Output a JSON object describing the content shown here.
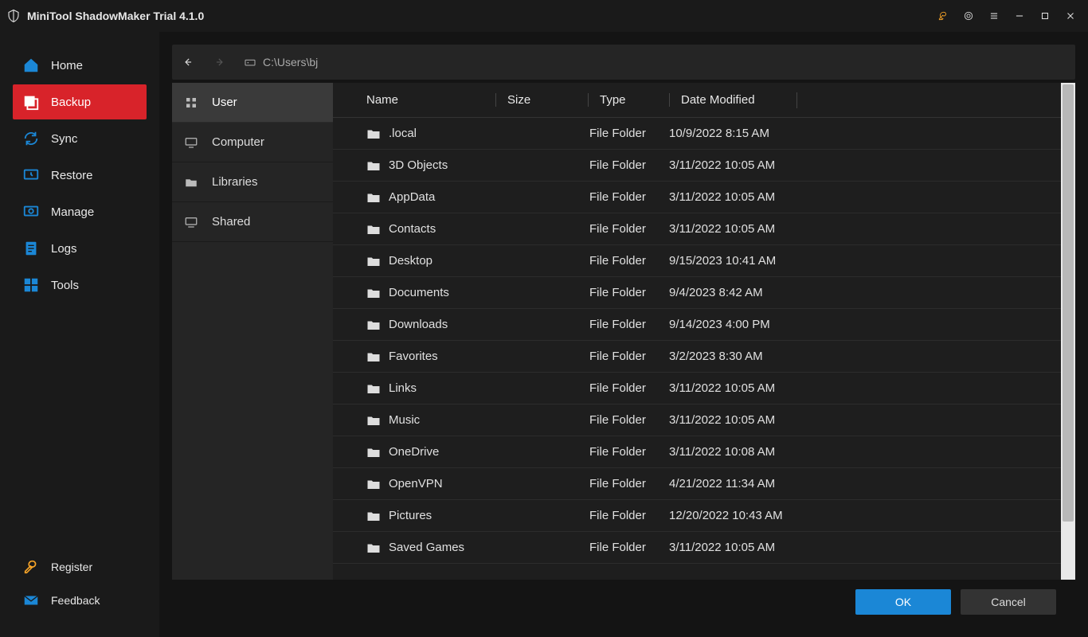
{
  "title": "MiniTool ShadowMaker Trial 4.1.0",
  "sidebar": {
    "items": [
      {
        "label": "Home"
      },
      {
        "label": "Backup"
      },
      {
        "label": "Sync"
      },
      {
        "label": "Restore"
      },
      {
        "label": "Manage"
      },
      {
        "label": "Logs"
      },
      {
        "label": "Tools"
      }
    ],
    "active_index": 1,
    "bottom": [
      {
        "label": "Register"
      },
      {
        "label": "Feedback"
      }
    ]
  },
  "browser": {
    "path": "C:\\Users\\bj",
    "categories": [
      {
        "label": "User"
      },
      {
        "label": "Computer"
      },
      {
        "label": "Libraries"
      },
      {
        "label": "Shared"
      }
    ],
    "active_category": 0,
    "columns": {
      "name": "Name",
      "size": "Size",
      "type": "Type",
      "date": "Date Modified"
    },
    "rows": [
      {
        "name": ".local",
        "type": "File Folder",
        "date": "10/9/2022 8:15 AM"
      },
      {
        "name": "3D Objects",
        "type": "File Folder",
        "date": "3/11/2022 10:05 AM"
      },
      {
        "name": "AppData",
        "type": "File Folder",
        "date": "3/11/2022 10:05 AM"
      },
      {
        "name": "Contacts",
        "type": "File Folder",
        "date": "3/11/2022 10:05 AM"
      },
      {
        "name": "Desktop",
        "type": "File Folder",
        "date": "9/15/2023 10:41 AM"
      },
      {
        "name": "Documents",
        "type": "File Folder",
        "date": "9/4/2023 8:42 AM"
      },
      {
        "name": "Downloads",
        "type": "File Folder",
        "date": "9/14/2023 4:00 PM"
      },
      {
        "name": "Favorites",
        "type": "File Folder",
        "date": "3/2/2023 8:30 AM"
      },
      {
        "name": "Links",
        "type": "File Folder",
        "date": "3/11/2022 10:05 AM"
      },
      {
        "name": "Music",
        "type": "File Folder",
        "date": "3/11/2022 10:05 AM"
      },
      {
        "name": "OneDrive",
        "type": "File Folder",
        "date": "3/11/2022 10:08 AM"
      },
      {
        "name": "OpenVPN",
        "type": "File Folder",
        "date": "4/21/2022 11:34 AM"
      },
      {
        "name": "Pictures",
        "type": "File Folder",
        "date": "12/20/2022 10:43 AM"
      },
      {
        "name": "Saved Games",
        "type": "File Folder",
        "date": "3/11/2022 10:05 AM"
      }
    ]
  },
  "footer": {
    "ok": "OK",
    "cancel": "Cancel"
  }
}
